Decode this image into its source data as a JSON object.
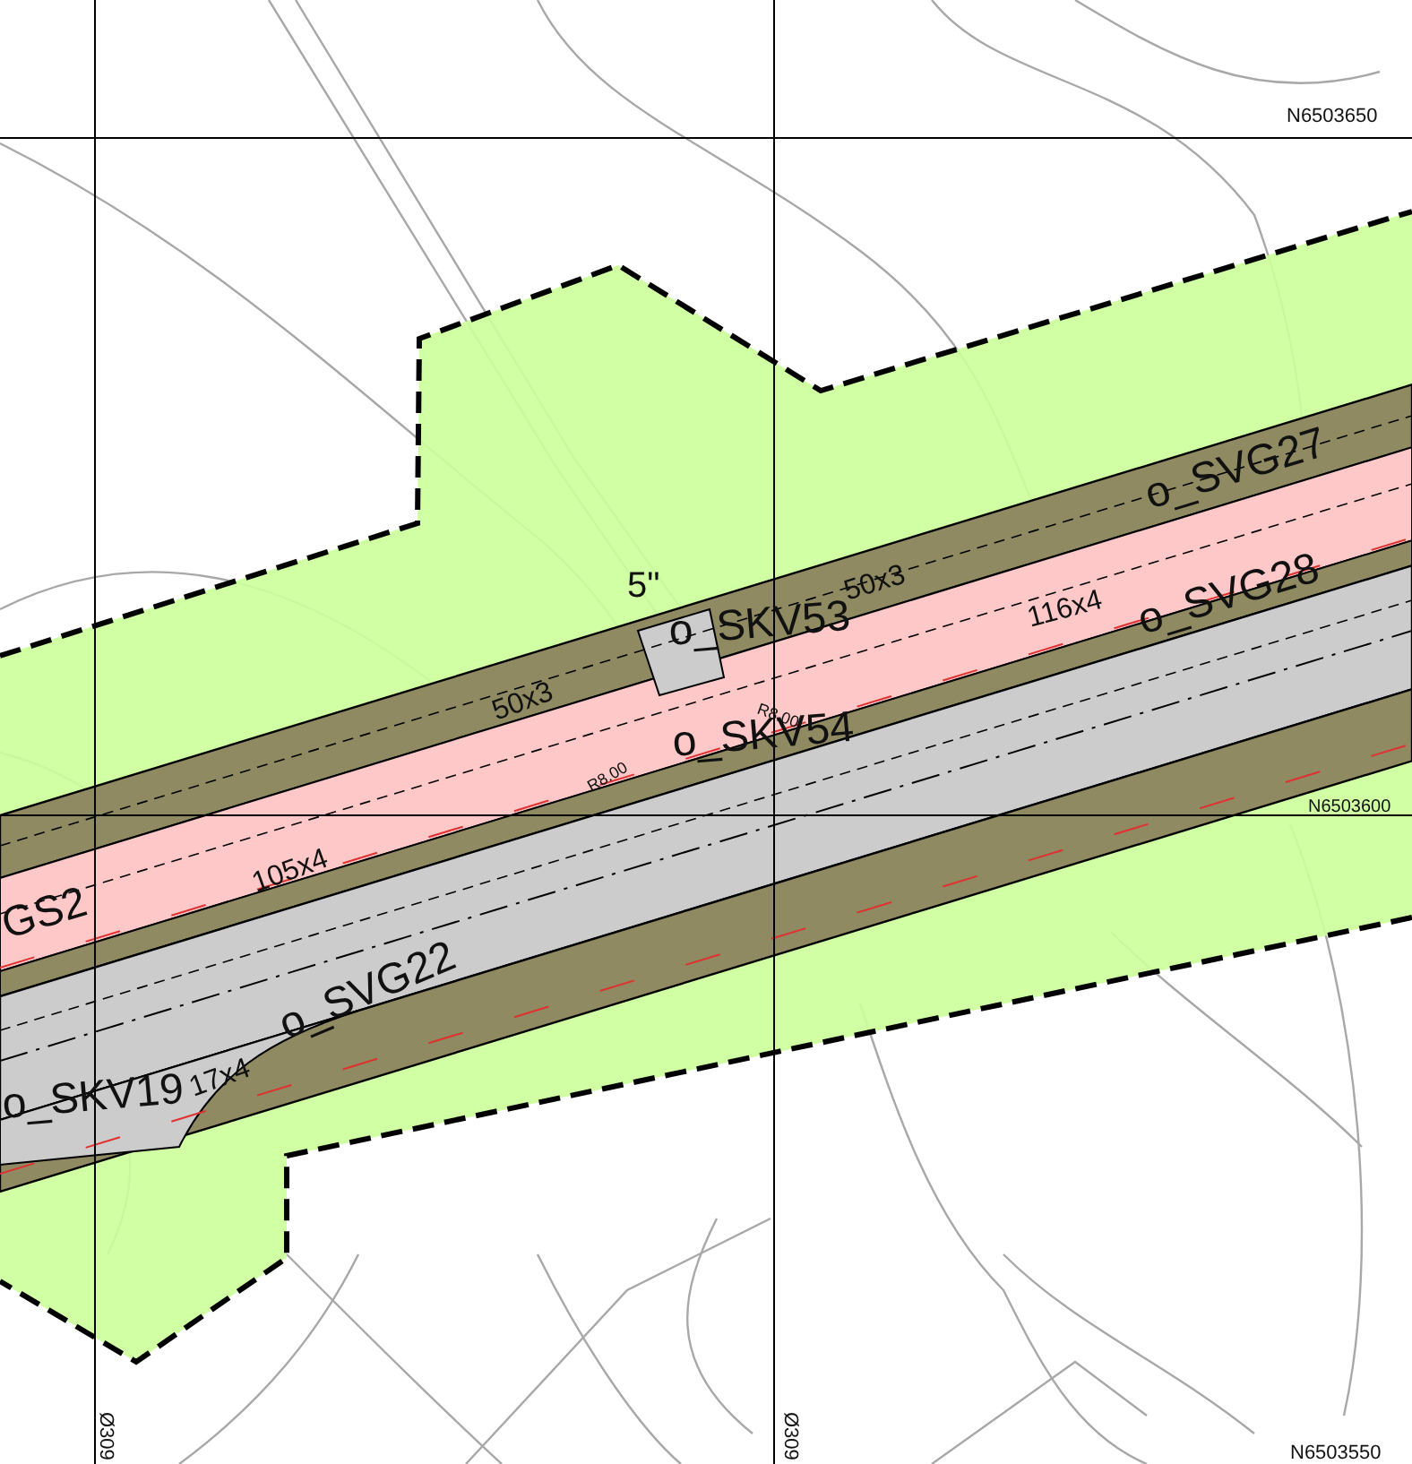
{
  "grid_labels": [
    {
      "text": "N6503650"
    },
    {
      "text": "N6503600"
    },
    {
      "text": "N6503550"
    },
    {
      "text": "Ø309"
    },
    {
      "text": "Ø309"
    }
  ],
  "area_labels": [
    {
      "text": "o_SVG27"
    },
    {
      "text": "o_SVG28"
    },
    {
      "text": "o_SKV53"
    },
    {
      "text": "o_SKV54"
    },
    {
      "text": "GS2"
    },
    {
      "text": "o_SVG22"
    },
    {
      "text": "o_SKV19"
    }
  ],
  "dimension_labels": [
    {
      "text": "5\""
    },
    {
      "text": "50x3"
    },
    {
      "text": "50x3"
    },
    {
      "text": "116x4"
    },
    {
      "text": "105x4"
    },
    {
      "text": "17x4"
    },
    {
      "text": "R8.00"
    },
    {
      "text": "R8.00"
    }
  ]
}
